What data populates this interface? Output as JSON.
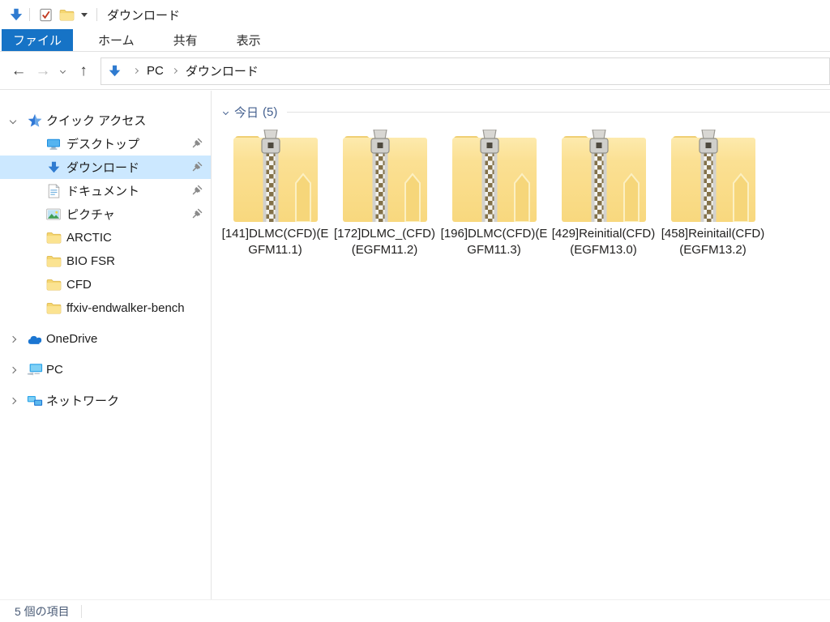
{
  "window": {
    "title": "ダウンロード"
  },
  "quick_access_toolbar": {
    "window_icon": "downloads-folder-icon",
    "properties_icon": "properties-icon",
    "new_folder_icon": "new-folder-icon",
    "customize_icon": "chevron-down-icon"
  },
  "tabs": {
    "file": "ファイル",
    "home": "ホーム",
    "share": "共有",
    "view": "表示"
  },
  "navigation": {
    "back_icon": "←",
    "forward_icon": "→",
    "up_icon": "↑",
    "breadcrumbs": {
      "pc": "PC",
      "downloads": "ダウンロード"
    }
  },
  "sidebar": {
    "quick_access_label": "クイック アクセス",
    "items": [
      {
        "label": "デスクトップ",
        "icon": "desktop-icon",
        "pinned": true
      },
      {
        "label": "ダウンロード",
        "icon": "download-arrow-icon",
        "pinned": true,
        "selected": true
      },
      {
        "label": "ドキュメント",
        "icon": "document-icon",
        "pinned": true
      },
      {
        "label": "ピクチャ",
        "icon": "pictures-icon",
        "pinned": true
      },
      {
        "label": "ARCTIC",
        "icon": "folder-icon"
      },
      {
        "label": "BIO FSR",
        "icon": "folder-icon"
      },
      {
        "label": "CFD",
        "icon": "folder-icon"
      },
      {
        "label": "ffxiv-endwalker-bench",
        "icon": "folder-icon"
      }
    ],
    "roots": [
      {
        "label": "OneDrive",
        "icon": "onedrive-cloud-icon"
      },
      {
        "label": "PC",
        "icon": "pc-icon"
      },
      {
        "label": "ネットワーク",
        "icon": "network-icon"
      }
    ]
  },
  "content": {
    "group_label": "今日",
    "group_count": "(5)",
    "files": [
      {
        "name": "[141]DLMC(CFD)(EGFM11.1)",
        "type": "zip-folder"
      },
      {
        "name": "[172]DLMC_(CFD)(EGFM11.2)",
        "type": "zip-folder"
      },
      {
        "name": "[196]DLMC(CFD)(EGFM11.3)",
        "type": "zip-folder"
      },
      {
        "name": "[429]Reinitial(CFD)(EGFM13.0)",
        "type": "zip-folder"
      },
      {
        "name": "[458]Reinitail(CFD)(EGFM13.2)",
        "type": "zip-folder"
      }
    ]
  },
  "statusbar": {
    "items_count": "5 個の項目"
  },
  "colors": {
    "accent_tab": "#1673c6",
    "selection": "#cce8ff",
    "folder_yellow": "#fadd8d",
    "blue_icon": "#2f7bd0",
    "group_header": "#44608f",
    "status_text": "#4a5b76"
  }
}
